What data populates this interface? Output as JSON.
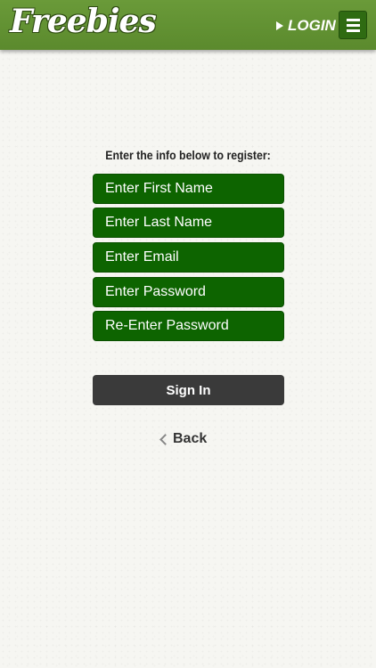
{
  "header": {
    "logo": "Freebies",
    "login_label": "LOGIN",
    "colors": {
      "bar": "#5f8f31",
      "menu_button": "#2f6b12"
    }
  },
  "form": {
    "instructions": "Enter the info below to register:",
    "fields": [
      {
        "placeholder": "Enter First Name",
        "value": ""
      },
      {
        "placeholder": "Enter Last Name",
        "value": ""
      },
      {
        "placeholder": "Enter Email",
        "value": ""
      },
      {
        "placeholder": "Enter Password",
        "value": ""
      },
      {
        "placeholder": "Re-Enter Password",
        "value": ""
      }
    ],
    "field_color": "#0d6400",
    "signin_label": "Sign In",
    "signin_color": "#3a3a3a",
    "back_label": "Back"
  },
  "icons": {
    "login": "play-arrow-icon",
    "menu": "hamburger-menu-icon",
    "back": "chevron-left-icon"
  }
}
